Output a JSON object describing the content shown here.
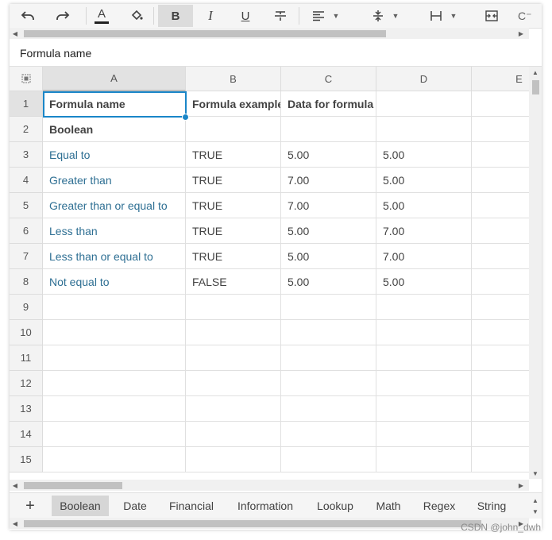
{
  "toolbar": {
    "items": [
      "undo-icon",
      "redo-icon",
      "font-color-icon",
      "fill-color-icon",
      "bold-icon",
      "italic-icon",
      "underline-icon",
      "strikethrough-icon",
      "align-icon",
      "valign-icon",
      "merge-icon",
      "wrap-icon",
      "more-icon"
    ],
    "bold_label": "B",
    "italic_label": "I",
    "underline_label": "U",
    "font_color_label": "A"
  },
  "formula_bar": {
    "value": "Formula name"
  },
  "columns": [
    "A",
    "B",
    "C",
    "D",
    "E"
  ],
  "rows": [
    "1",
    "2",
    "3",
    "4",
    "5",
    "6",
    "7",
    "8",
    "9",
    "10",
    "11",
    "12",
    "13",
    "14",
    "15"
  ],
  "cells": [
    [
      "Formula name",
      "Formula example",
      "Data for formula",
      ""
    ],
    [
      "Boolean",
      "",
      "",
      ""
    ],
    [
      "Equal to",
      "TRUE",
      "5.00",
      "5.00"
    ],
    [
      "Greater than",
      "TRUE",
      "7.00",
      "5.00"
    ],
    [
      "Greater than or equal to",
      "TRUE",
      "7.00",
      "5.00"
    ],
    [
      "Less than",
      "TRUE",
      "5.00",
      "7.00"
    ],
    [
      "Less than or equal to",
      "TRUE",
      "5.00",
      "7.00"
    ],
    [
      "Not equal to",
      "FALSE",
      "5.00",
      "5.00"
    ]
  ],
  "sheet_tabs": {
    "add_label": "+",
    "tabs": [
      "Boolean",
      "Date",
      "Financial",
      "Information",
      "Lookup",
      "Math",
      "Regex",
      "String"
    ],
    "active": "Boolean"
  },
  "watermark": "CSDN @john_dwh",
  "colors": {
    "accent": "#1a86c8",
    "link": "#2e6f93"
  }
}
